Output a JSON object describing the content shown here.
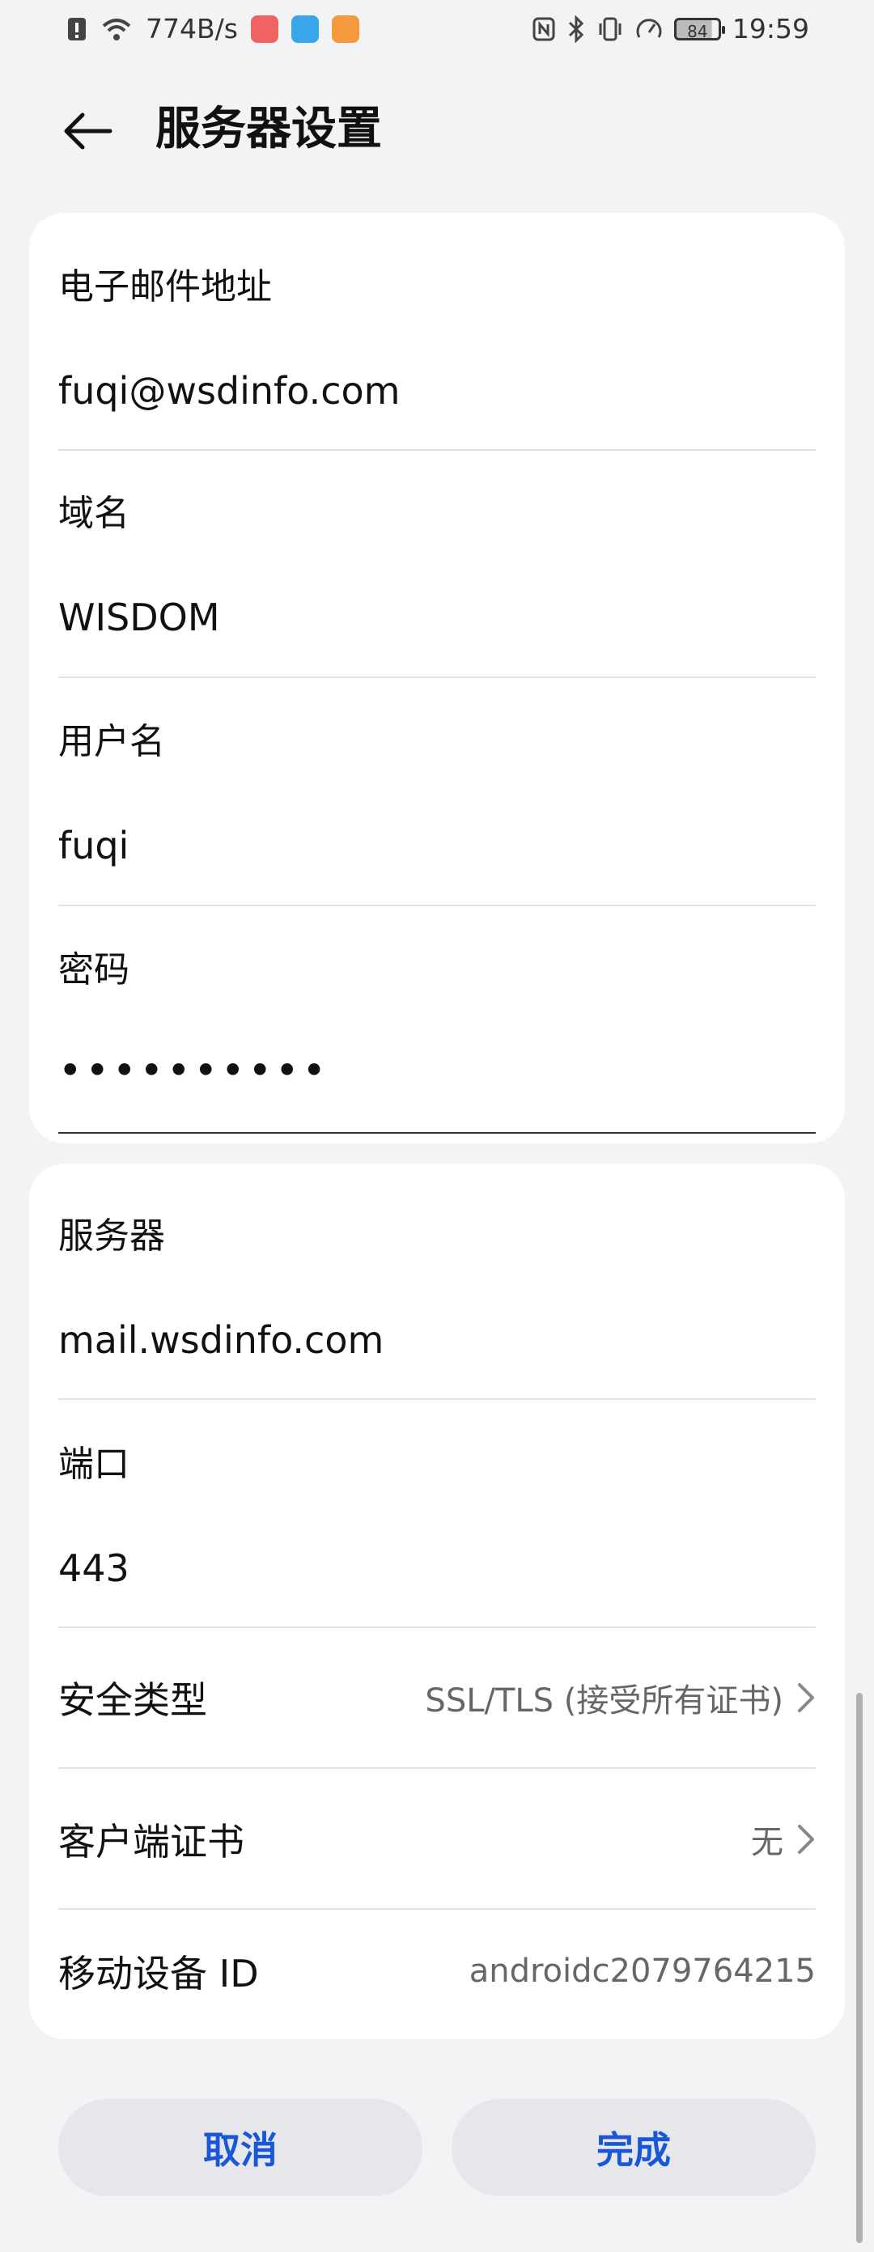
{
  "status_bar": {
    "network_speed": "774B/s",
    "battery": "84",
    "time": "19:59"
  },
  "header": {
    "title": "服务器设置"
  },
  "account": {
    "email_label": "电子邮件地址",
    "email_value": "fuqi@wsdinfo.com",
    "domain_label": "域名",
    "domain_value": "WISDOM",
    "username_label": "用户名",
    "username_value": "fuqi",
    "password_label": "密码",
    "password_value": "••••••••••"
  },
  "server": {
    "server_label": "服务器",
    "server_value": "mail.wsdinfo.com",
    "port_label": "端口",
    "port_value": "443",
    "security_label": "安全类型",
    "security_value": "SSL/TLS (接受所有证书)",
    "cert_label": "客户端证书",
    "cert_value": "无",
    "device_id_label": "移动设备 ID",
    "device_id_value": "androidc2079764215"
  },
  "buttons": {
    "cancel": "取消",
    "done": "完成"
  },
  "colors": {
    "accent": "#1a57d8",
    "background": "#f1f3f5",
    "card": "#ffffff"
  }
}
